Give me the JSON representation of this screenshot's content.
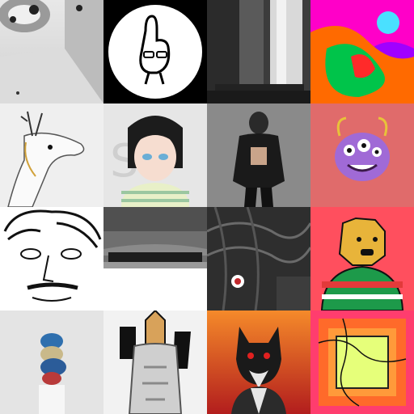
{
  "gallery": {
    "tiles": [
      {
        "icon": "white-room-image",
        "accent": "#d9d9d9"
      },
      {
        "icon": "finger-character-logo",
        "accent": "#000000"
      },
      {
        "icon": "waterfall-photo",
        "accent": "#4a4a4a"
      },
      {
        "icon": "psychedelic-swirl-art",
        "accent": "#ff00c8"
      },
      {
        "icon": "white-creature-sketch",
        "accent": "#e6e6e6"
      },
      {
        "icon": "anime-girl-portrait",
        "accent": "#cfcfcf"
      },
      {
        "icon": "woman-in-fringe-jacket-photo",
        "accent": "#6e6e6e"
      },
      {
        "icon": "purple-monster-character",
        "accent": "#e06b6b"
      },
      {
        "icon": "doodled-face-drawing",
        "accent": "#ffffff"
      },
      {
        "icon": "elephant-herd-photo",
        "accent": "#7f7f7f"
      },
      {
        "icon": "dark-abstract-net-art",
        "accent": "#3a3a3a"
      },
      {
        "icon": "dog-in-christmas-sweater",
        "accent": "#ff4f5e"
      },
      {
        "icon": "stacked-spheres-sculpture",
        "accent": "#e0e0e0"
      },
      {
        "icon": "masked-warrior-illustration",
        "accent": "#bdbdbd"
      },
      {
        "icon": "fox-character-portrait",
        "accent": "#c9311c"
      },
      {
        "icon": "neon-square-frame-art",
        "accent": "#ff3d6e"
      }
    ]
  }
}
